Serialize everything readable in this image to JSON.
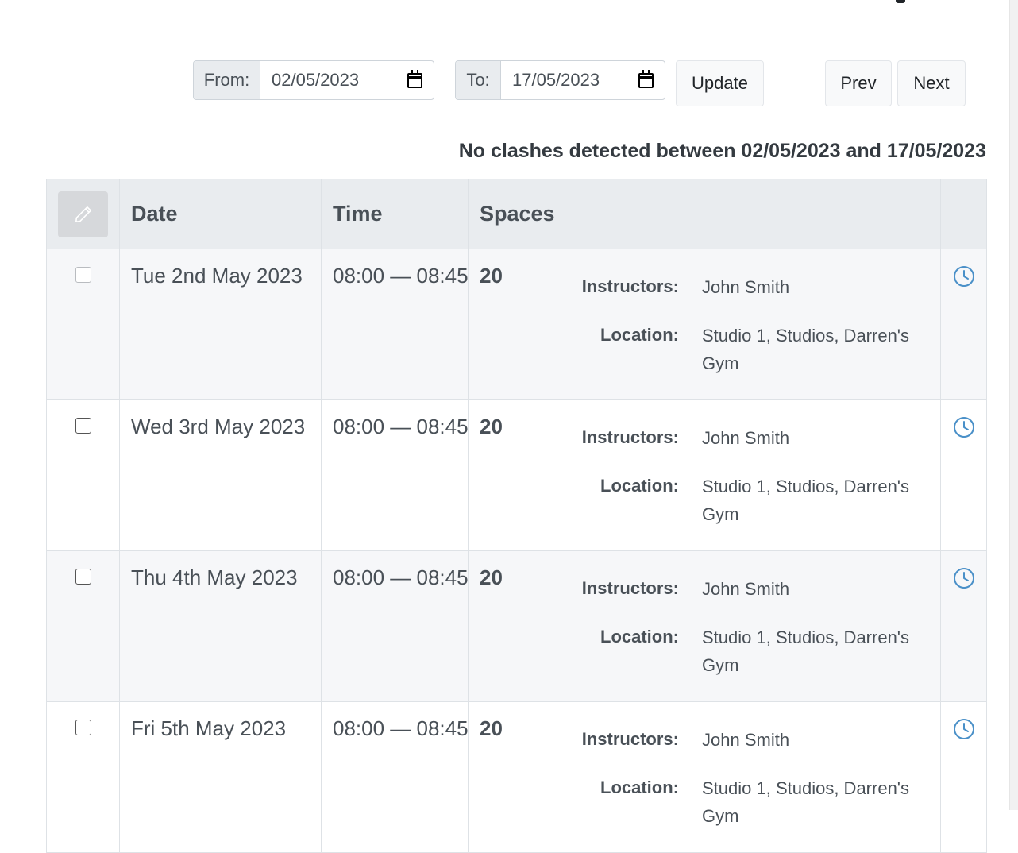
{
  "filters": {
    "from_label": "From:",
    "from_value": "02/05/2023",
    "to_label": "To:",
    "to_value": "17/05/2023",
    "update_label": "Update",
    "prev_label": "Prev",
    "next_label": "Next"
  },
  "message": "No clashes detected between 02/05/2023 and 17/05/2023",
  "table": {
    "headers": [
      "Date",
      "Time",
      "Spaces",
      ""
    ],
    "instructors_label": "Instructors:",
    "location_label": "Location:",
    "rows": [
      {
        "date": "Tue 2nd May 2023",
        "time": "08:00 — 08:45",
        "spaces": "20",
        "instructors": "John Smith",
        "location": "Studio 1, Studios, Darren's Gym"
      },
      {
        "date": "Wed 3rd May 2023",
        "time": "08:00 — 08:45",
        "spaces": "20",
        "instructors": "John Smith",
        "location": "Studio 1, Studios, Darren's Gym"
      },
      {
        "date": "Thu 4th May 2023",
        "time": "08:00 — 08:45",
        "spaces": "20",
        "instructors": "John Smith",
        "location": "Studio 1, Studios, Darren's Gym"
      },
      {
        "date": "Fri 5th May 2023",
        "time": "08:00 — 08:45",
        "spaces": "20",
        "instructors": "John Smith",
        "location": "Studio 1, Studios, Darren's Gym"
      }
    ]
  },
  "icons": {
    "edit": "pencil-icon",
    "calendar": "calendar-icon",
    "history": "clock-icon"
  },
  "colors": {
    "accent": "#4a90c8",
    "header_bg": "#e9ecef",
    "stripe": "#f6f7f9"
  }
}
